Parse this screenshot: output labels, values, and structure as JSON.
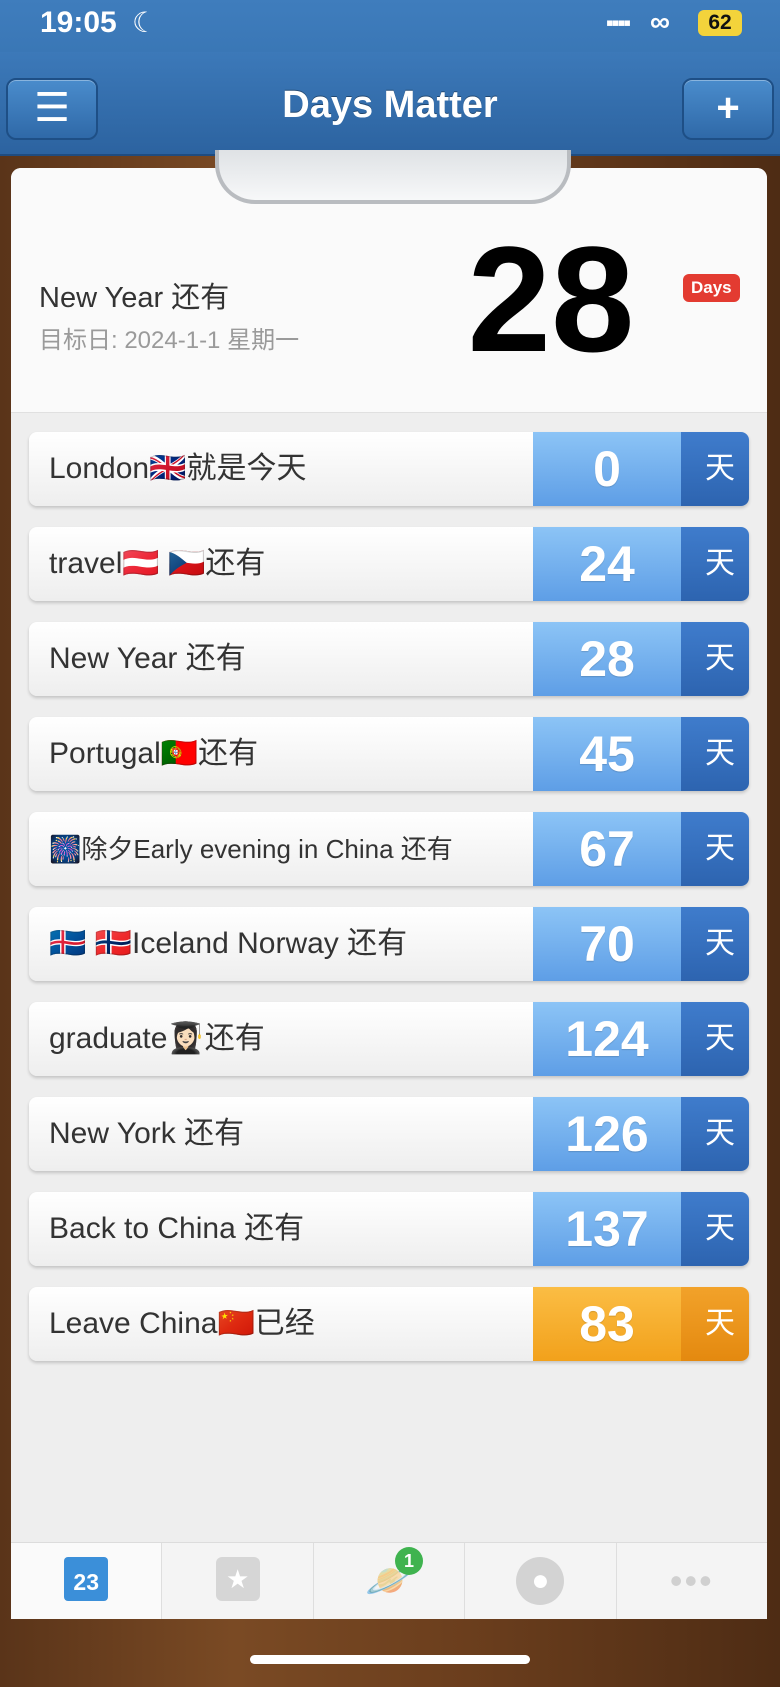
{
  "status": {
    "time": "19:05",
    "battery": "62"
  },
  "app": {
    "title": "Days Matter",
    "menu_icon": "☰",
    "add_icon": "+"
  },
  "hero": {
    "title": "New Year 还有",
    "target_date": "目标日: 2024-1-1 星期一",
    "count": "28",
    "unit": "Days"
  },
  "events": [
    {
      "label": "London🇬🇧就是今天",
      "count": "0",
      "unit": "天",
      "state": "future"
    },
    {
      "label": "travel🇦🇹 🇨🇿还有",
      "count": "24",
      "unit": "天",
      "state": "future"
    },
    {
      "label": "New Year 还有",
      "count": "28",
      "unit": "天",
      "state": "future"
    },
    {
      "label": "Portugal🇵🇹还有",
      "count": "45",
      "unit": "天",
      "state": "future"
    },
    {
      "label": "🎆除夕Early evening in China 还有",
      "count": "67",
      "unit": "天",
      "state": "future"
    },
    {
      "label": "🇮🇸 🇳🇴Iceland Norway 还有",
      "count": "70",
      "unit": "天",
      "state": "future"
    },
    {
      "label": "graduate👩🏻‍🎓还有",
      "count": "124",
      "unit": "天",
      "state": "future"
    },
    {
      "label": "New York 还有",
      "count": "126",
      "unit": "天",
      "state": "future"
    },
    {
      "label": "Back to China 还有",
      "count": "137",
      "unit": "天",
      "state": "future"
    },
    {
      "label": "Leave China🇨🇳已经",
      "count": "83",
      "unit": "天",
      "state": "past"
    }
  ],
  "tabbar": {
    "calendar_day": "23",
    "discover_badge": "1"
  },
  "colors": {
    "nav_blue": "#3a77b6",
    "count_blue": "#6aa8ea",
    "unit_blue": "#3470bd",
    "past_orange": "#f5ac2a",
    "badge_red": "#e33b31",
    "badge_green": "#3fb34f"
  }
}
